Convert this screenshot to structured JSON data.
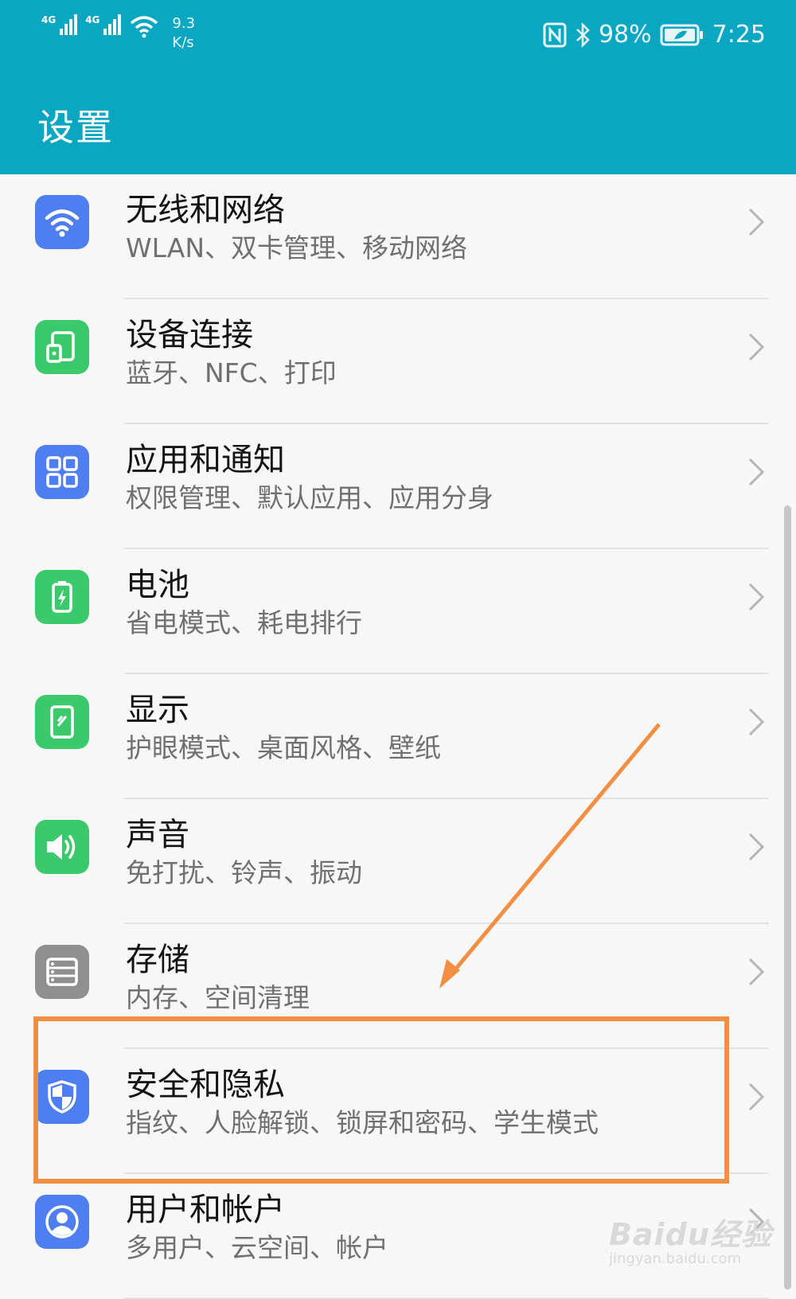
{
  "status_bar": {
    "signal1_label": "4G",
    "signal2_label": "4G",
    "speed_value": "9.3",
    "speed_unit": "K/s",
    "battery_percent": "98%",
    "time": "7:25"
  },
  "header": {
    "title": "设置"
  },
  "settings_items": [
    {
      "title": "无线和网络",
      "subtitle": "WLAN、双卡管理、移动网络",
      "icon": "wifi-icon",
      "color": "#4f7ef0"
    },
    {
      "title": "设备连接",
      "subtitle": "蓝牙、NFC、打印",
      "icon": "device-connection-icon",
      "color": "#3cc96b"
    },
    {
      "title": "应用和通知",
      "subtitle": "权限管理、默认应用、应用分身",
      "icon": "apps-grid-icon",
      "color": "#4f7ef0"
    },
    {
      "title": "电池",
      "subtitle": "省电模式、耗电排行",
      "icon": "battery-icon",
      "color": "#3cc96b"
    },
    {
      "title": "显示",
      "subtitle": "护眼模式、桌面风格、壁纸",
      "icon": "display-icon",
      "color": "#3cc96b"
    },
    {
      "title": "声音",
      "subtitle": "免打扰、铃声、振动",
      "icon": "speaker-icon",
      "color": "#3cc96b"
    },
    {
      "title": "存储",
      "subtitle": "内存、空间清理",
      "icon": "storage-icon",
      "color": "#8f8f8f"
    },
    {
      "title": "安全和隐私",
      "subtitle": "指纹、人脸解锁、锁屏和密码、学生模式",
      "icon": "shield-icon",
      "color": "#4f7ef0"
    },
    {
      "title": "用户和帐户",
      "subtitle": "多用户、云空间、帐户",
      "icon": "user-account-icon",
      "color": "#4f7ef0"
    }
  ],
  "annotation": {
    "color": "#f28f43",
    "highlighted_item": "安全和隐私"
  },
  "watermark": {
    "brand": "Baidu经验",
    "url": "jingyan.baidu.com"
  },
  "colors": {
    "header_bg": "#0aa6c2",
    "page_bg": "#f7f7f7"
  }
}
